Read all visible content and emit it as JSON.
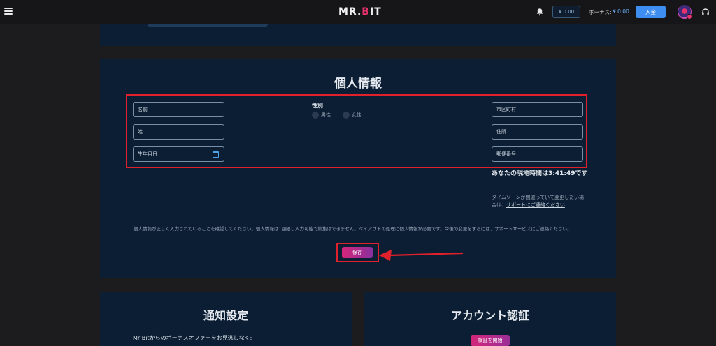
{
  "header": {
    "logo_text_left": "MR.",
    "logo_text_accent": "B",
    "logo_text_right": "IT",
    "balance": "¥ 0.00",
    "bonus_label": "ボーナス:",
    "bonus_amount": "¥ 0.00",
    "deposit_label": "入金"
  },
  "personal_info": {
    "title": "個人情報",
    "fields": {
      "first_name": "名前",
      "last_name": "姓",
      "birth_date": "生年月日",
      "city": "市区町村",
      "address": "住所",
      "postal_code": "郵便番号"
    },
    "gender": {
      "label": "性別",
      "options": [
        "男性",
        "女性"
      ]
    },
    "timezone_title": "あなたの現地時間は3:41:49です",
    "timezone_note": "タイムゾーンが間違っていて変更したい場合は、",
    "timezone_link": "サポートにご連絡ください",
    "disclaimer": "個人情報が正しく入力されていることを確認してください。個人情報は1回限り入力可能で編集はできません。ペイアウトの処理に個人情報が必要です。今後の変更をするには、サポートサービスにご連絡ください。",
    "save_label": "保存"
  },
  "notifications": {
    "title": "通知設定",
    "subtitle": "Mr Bitからのボーナスオファーをお見逃しなく:"
  },
  "account_verification": {
    "title": "アカウント認証",
    "verify_label": "検証を開始"
  },
  "colors": {
    "accent": "#e8326e",
    "panel": "#0b1e33",
    "highlight_frame": "#e0202a",
    "deposit": "#3d8ef0"
  }
}
